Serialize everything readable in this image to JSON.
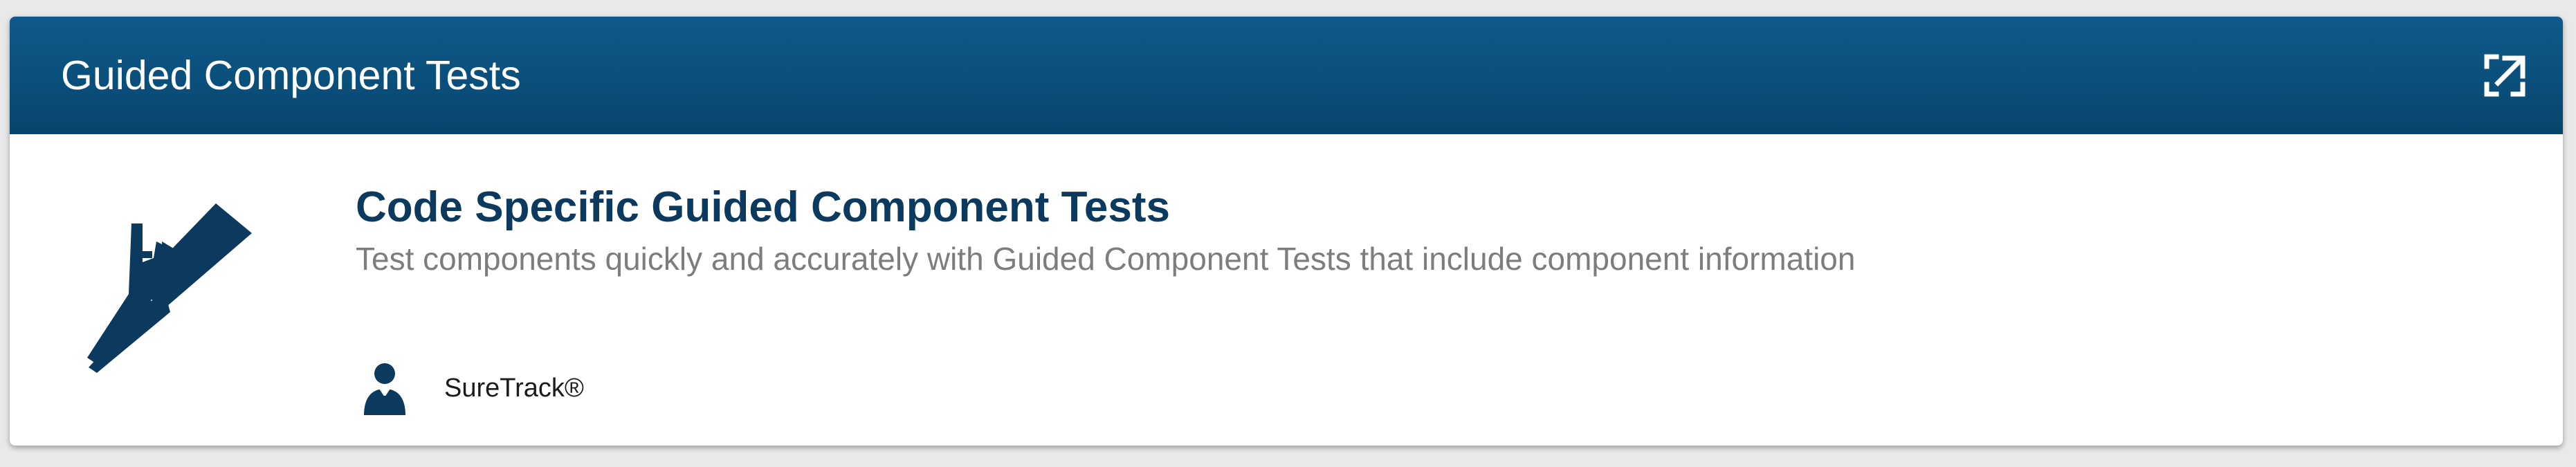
{
  "header": {
    "title": "Guided Component Tests",
    "expand_icon": "expand-icon"
  },
  "item": {
    "icon": "test-probe-icon",
    "title": "Code Specific Guided Component Tests",
    "description": "Test components quickly and accurately with Guided Component Tests that include component information",
    "source_icon": "user-tie-icon",
    "source_label": "SureTrack®"
  },
  "colors": {
    "header_bg": "#0b4f7c",
    "title_text": "#0b3a5e",
    "description_text": "#7d7d7d",
    "icon_color": "#0b3a5e",
    "page_bg": "#e9e9e9"
  }
}
